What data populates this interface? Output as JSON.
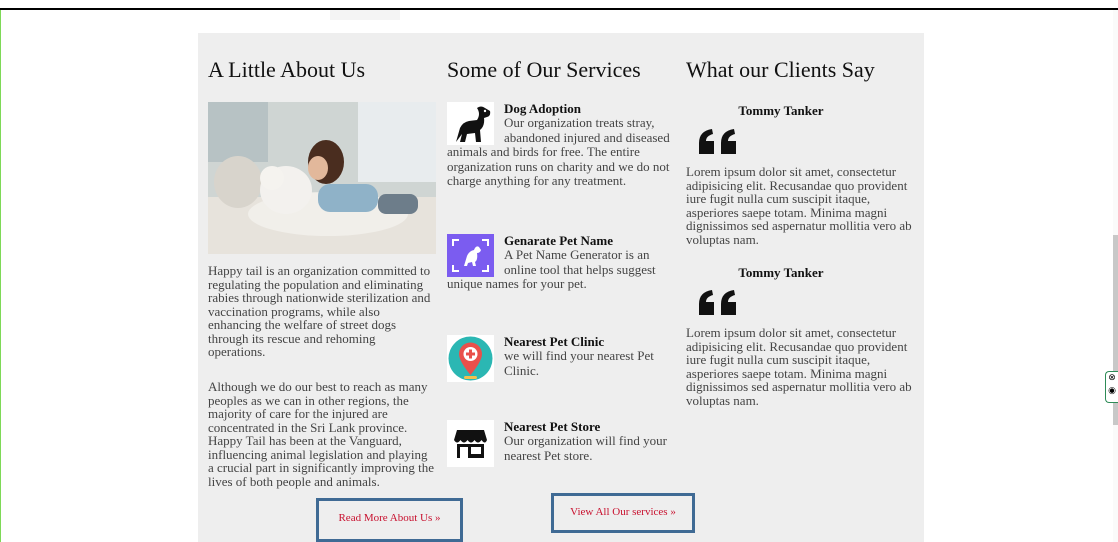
{
  "about": {
    "heading": "A Little About Us",
    "paragraph1": "Happy tail is an organization committed to regulating the population and eliminating rabies through nationwide sterilization and vaccination programs, while also enhancing the welfare of street dogs through its rescue and rehoming operations.",
    "paragraph2": "Although we do our best to reach as many peoples as we can in other regions, the majority of care for the injured are concentrated in the Sri Lank province. Happy Tail has been at the Vanguard, influencing animal legislation and playing a crucial part in significantly improving the lives of both people and animals.",
    "button_label": "Read More About Us »"
  },
  "services": {
    "heading": "Some of Our Services",
    "items": [
      {
        "title": "Dog Adoption",
        "description": "Our organization treats stray, abandoned injured and diseased animals and birds for free. The entire organization runs on charity and we do not charge anything for any treatment.",
        "icon": "dog-icon"
      },
      {
        "title": "Genarate Pet Name",
        "description": "A Pet Name Generator is an online tool that helps suggest unique names for your pet.",
        "icon": "pet-name-icon"
      },
      {
        "title": "Nearest Pet Clinic",
        "description": "we will find your nearest Pet Clinic.",
        "icon": "clinic-location-icon"
      },
      {
        "title": "Nearest Pet Store",
        "description": "Our organization will find your nearest Pet store.",
        "icon": "store-icon"
      }
    ],
    "button_label": "View All Our services »"
  },
  "clients": {
    "heading": "What our Clients Say",
    "testimonials": [
      {
        "name": "Tommy Tanker",
        "text": "Lorem ipsum dolor sit amet, consectetur adipisicing elit. Recusandae quo provident iure fugit nulla cum suscipit itaque, asperiores saepe totam. Minima magni dignissimos sed aspernatur mollitia vero ab voluptas nam."
      },
      {
        "name": "Tommy Tanker",
        "text": "Lorem ipsum dolor sit amet, consectetur adipisicing elit. Recusandae quo provident iure fugit nulla cum suscipit itaque, asperiores saepe totam. Minima magni dignissimos sed aspernatur mollitia vero ab voluptas nam."
      }
    ]
  },
  "colors": {
    "panel_bg": "#eeeeee",
    "button_border": "#3f6a94",
    "button_text": "#c8102e",
    "pet_name_icon_bg": "#7b5cf0",
    "clinic_icon_bg": "#2bb7b3",
    "clinic_pin": "#e9504b"
  }
}
